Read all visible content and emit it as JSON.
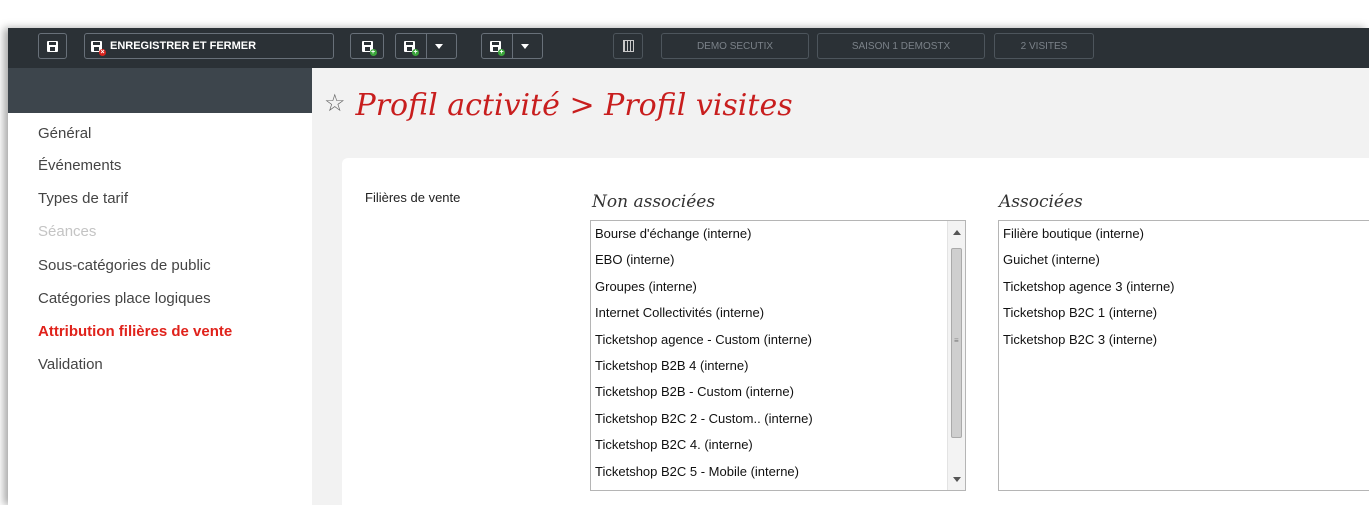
{
  "toolbar": {
    "save_close_label": "ENREGISTRER ET FERMER",
    "context": [
      "DEMO SECUTIX",
      "SAISON 1 DEMOSTX",
      "2 VISITES"
    ]
  },
  "page": {
    "title": "Profil activité > Profil visites"
  },
  "sidebar": {
    "items": [
      {
        "label": "Général"
      },
      {
        "label": "Événements"
      },
      {
        "label": "Types de tarif"
      },
      {
        "label": "Séances"
      },
      {
        "label": "Sous-catégories de public"
      },
      {
        "label": "Catégories place logiques"
      },
      {
        "label": "Attribution filières de vente"
      },
      {
        "label": "Validation"
      }
    ]
  },
  "form": {
    "field_label": "Filières de vente",
    "non_associated_title": "Non associées",
    "associated_title": "Associées",
    "non_associated": [
      "Bourse d'échange (interne)",
      "EBO (interne)",
      "Groupes (interne)",
      "Internet Collectivités (interne)",
      "Ticketshop agence - Custom (interne)",
      "Ticketshop B2B 4 (interne)",
      "Ticketshop B2B - Custom (interne)",
      "Ticketshop B2C 2 - Custom.. (interne)",
      "Ticketshop B2C 4. (interne)",
      "Ticketshop B2C 5 - Mobile (interne)"
    ],
    "associated": [
      "Filière boutique (interne)",
      "Guichet (interne)",
      "Ticketshop agence 3 (interne)",
      "Ticketshop B2C 1 (interne)",
      "Ticketshop B2C 3 (interne)"
    ]
  },
  "colors": {
    "accent_red": "#e0221b",
    "title_red": "#c81e1e",
    "toolbar_bg": "#2b3136"
  },
  "icons": [
    "save-icon",
    "save-close-icon",
    "save-new-icon",
    "dropdown-caret-icon",
    "calendar-icon",
    "star-icon",
    "move-all-right-icon",
    "move-right-icon",
    "move-left-icon",
    "move-all-left-icon"
  ]
}
